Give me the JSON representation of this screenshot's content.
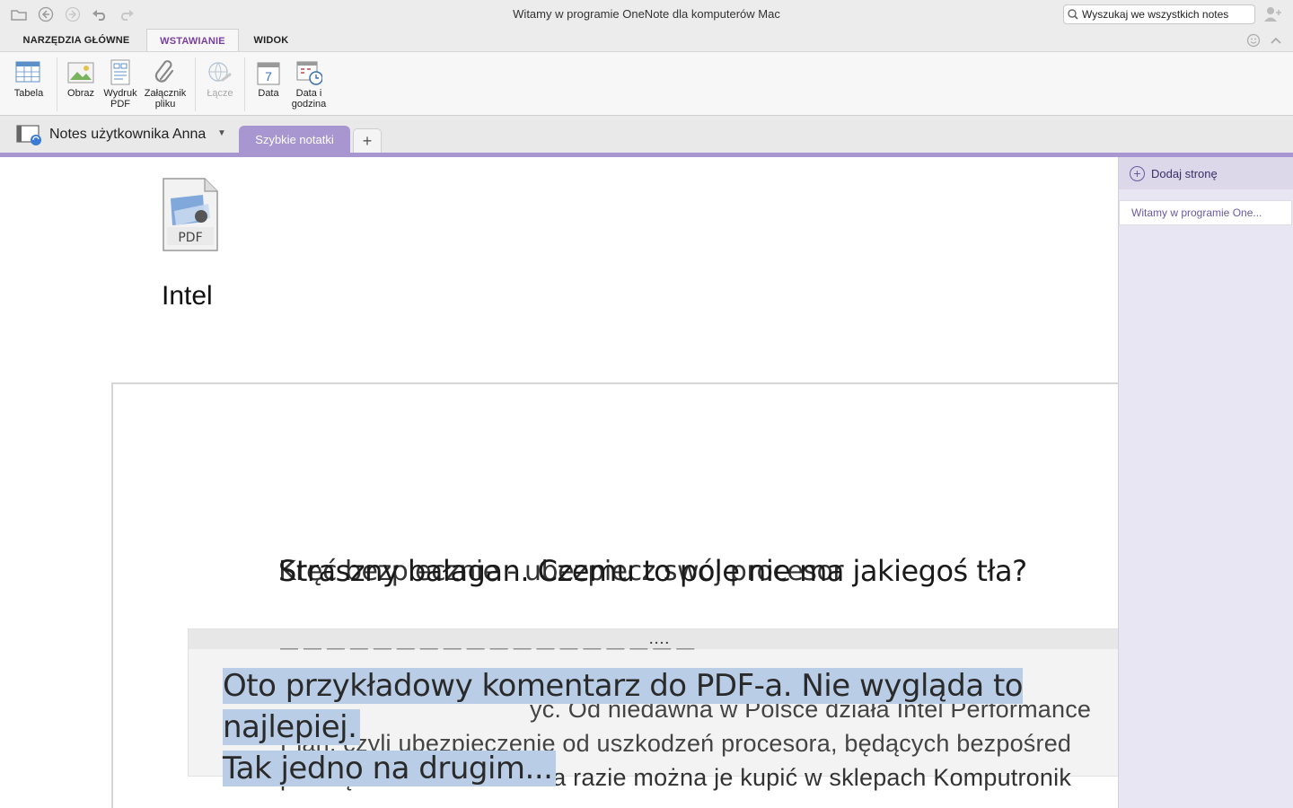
{
  "window": {
    "title": "Witamy w programie OneNote dla komputerów Mac"
  },
  "search": {
    "placeholder": "Wyszukaj we wszystkich notesach",
    "value": "Wyszukaj we wszystkich notes"
  },
  "ribbon": {
    "tabs": [
      {
        "label": "NARZĘDZIA GŁÓWNE",
        "active": false
      },
      {
        "label": "WSTAWIANIE",
        "active": true
      },
      {
        "label": "WIDOK",
        "active": false
      }
    ],
    "buttons": {
      "table": "Tabela",
      "picture": "Obraz",
      "pdf_printout": "Wydruk PDF",
      "attachment": "Załącznik pliku",
      "link": "Łącze",
      "date": "Data",
      "date_icon_number": "7",
      "datetime": "Data i godzina"
    }
  },
  "notebook": {
    "name": "Notes użytkownika Anna",
    "caret": "▼",
    "section": "Szybkie notatki",
    "add_section": "+"
  },
  "pages": {
    "add_page": "Dodaj stronę",
    "items": [
      "Witamy w programie One..."
    ]
  },
  "canvas": {
    "pdf_icon_label": "PDF",
    "attachment_title": "Intel",
    "heading_under": "Kręć bezpiecznie - ubezpiecz swój procesor",
    "heading_over": "Straszny bałagan. Czemu to pole nie ma jakiegoś tła?",
    "note_grip": "....",
    "comment_line1": "Oto przykładowy komentarz do PDF-a. Nie wygląda to najlepiej.",
    "comment_line2": "Tak jedno na drugim...",
    "body_line0": "— — — — — — — — — — — — — — — — — —",
    "body_line1": "yc. Od niedawna w Polsce działa Intel Performance",
    "body_line2": "Plan, czyli ubezpieczenie od uszkodzeń procesora, będących bezpośred",
    "body_line3": "podkręcania. W Polsce na razie można je kupić w sklepach Komputronik"
  },
  "colors": {
    "accent": "#a796cf",
    "active_tab_text": "#7a3fa0",
    "highlight": "#b9cde6"
  }
}
